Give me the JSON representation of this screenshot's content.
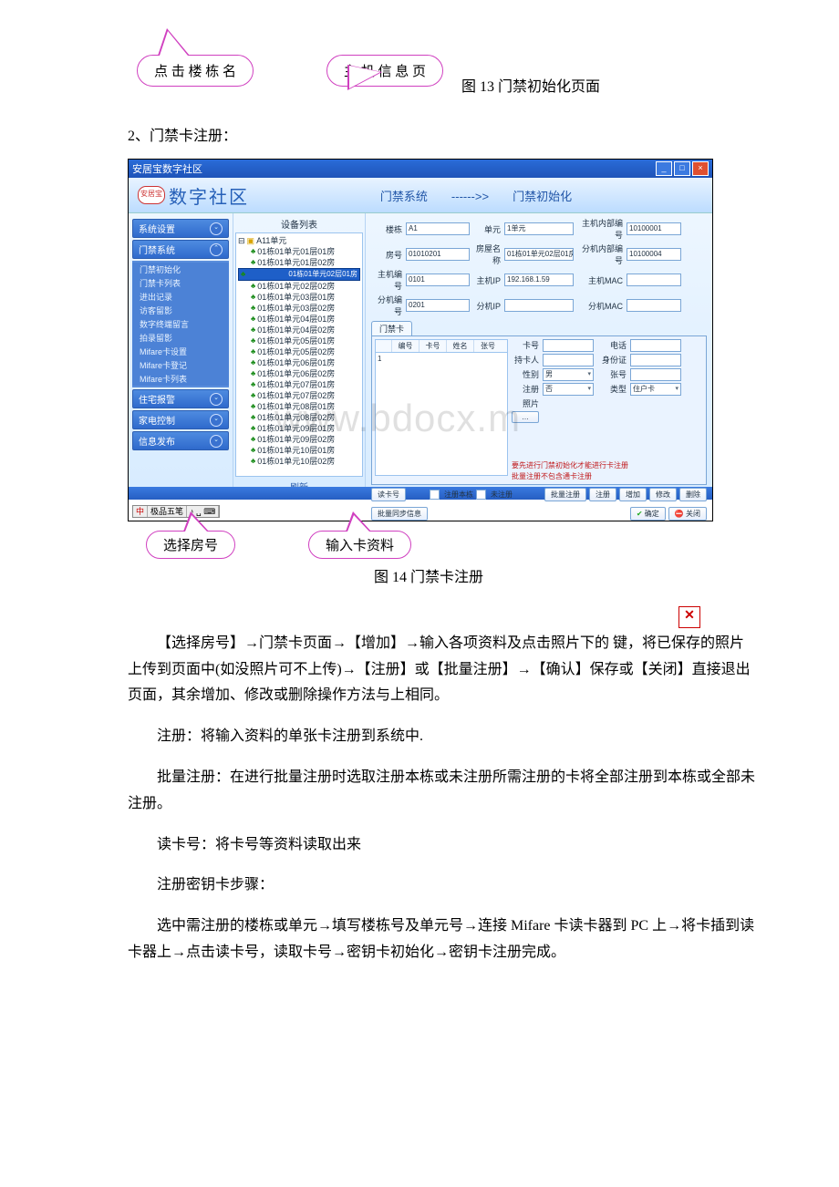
{
  "callouts_top": {
    "left": "点 击 楼 栋 名",
    "right": "主 机 信 息 页"
  },
  "fig13": "图 13 门禁初始化页面",
  "section2": "2、门禁卡注册：",
  "watermark": "www.bdocx.m",
  "screenshot": {
    "window_title": "安居宝数字社区",
    "logo_badge": "安居宝",
    "logo_text": "数字社区",
    "header_center": "门禁系统　　------>>　　门禁初始化",
    "leftnav": {
      "groups": [
        {
          "label": "系统设置",
          "items": []
        },
        {
          "label": "门禁系统",
          "items": [
            "门禁初始化",
            "门禁卡列表",
            "进出记录",
            "访客留影",
            "数字终端留言",
            "拍录留影",
            "Mifare卡设置",
            "Mifare卡登记",
            "Mifare卡列表"
          ]
        },
        {
          "label": "住宅报警",
          "items": []
        },
        {
          "label": "家电控制",
          "items": []
        },
        {
          "label": "信息发布",
          "items": []
        }
      ]
    },
    "tree": {
      "title": "设备列表",
      "root": "A11单元",
      "rows": [
        "01栋01单元01层01房",
        "01栋01单元01层02房",
        "01栋01单元02层01房",
        "01栋01单元02层02房",
        "01栋01单元03层01房",
        "01栋01单元03层02房",
        "01栋01单元04层01房",
        "01栋01单元04层02房",
        "01栋01单元05层01房",
        "01栋01单元05层02房",
        "01栋01单元06层01房",
        "01栋01单元06层02房",
        "01栋01单元07层01房",
        "01栋01单元07层02房",
        "01栋01单元08层01房",
        "01栋01单元08层02房",
        "01栋01单元09层01房",
        "01栋01单元09层02房",
        "01栋01单元10层01房",
        "01栋01单元10层02房"
      ],
      "selected_index": 2,
      "refresh": "刷新"
    },
    "form": {
      "l_block": "楼栋",
      "v_block": "A1",
      "l_unit": "单元",
      "v_unit": "1单元",
      "l_hostno": "主机内部编号",
      "v_hostno": "10100001",
      "l_room": "房号",
      "v_room": "01010201",
      "l_roomname": "房屋名称",
      "v_roomname": "01栋01单元02层01房",
      "l_extno": "分机内部编号",
      "v_extno": "10100004",
      "l_hostnum": "主机编号",
      "v_hostnum": "0101",
      "l_hostip": "主机IP",
      "v_hostip": "192.168.1.59",
      "l_hostmac": "主机MAC",
      "v_hostmac": "",
      "l_extnum": "分机编号",
      "v_extnum": "0201",
      "l_extip": "分机IP",
      "v_extip": "",
      "l_extmac": "分机MAC",
      "v_extmac": ""
    },
    "tab": {
      "name": "门禁卡",
      "cols": [
        "",
        "编号",
        "卡号",
        "姓名",
        "张号"
      ],
      "row1": "1"
    },
    "rightform": {
      "l_cardno": "卡号",
      "v_cardno": "",
      "l_phone": "电话",
      "v_phone": "",
      "l_holder": "持卡人",
      "v_holder": "",
      "l_idcard": "身份证",
      "v_idcard": "",
      "l_gender": "性别",
      "v_gender": "男",
      "l_zhang": "张号",
      "v_zhang": "",
      "l_reg": "注册",
      "v_reg": "否",
      "l_type": "类型",
      "v_type": "住户卡",
      "l_photo": "照片",
      "photo_btn": "…",
      "warn1": "要先进行门禁初始化才能进行卡注册",
      "warn2": "批量注册不包含通卡注册"
    },
    "btns": {
      "readcard": "读卡号",
      "regblock": "注册本栋",
      "unreg": "未注册",
      "batchreg": "批量注册",
      "reg": "注册",
      "add": "增加",
      "modify": "修改",
      "delete": "删除",
      "batchsync": "批量同步信息",
      "ok": "确定",
      "close": "关闭"
    },
    "ime": {
      "seg1": "极品五笔",
      "seg_icons": "♪  ␣  ⌨"
    }
  },
  "callouts_mid": {
    "left": "选择房号",
    "right": "输入卡资料"
  },
  "fig14": "图 14 门禁卡注册",
  "steps_para_pre": "【选择房号】→门禁卡页面→【增加】→输入各项资料及点击照片下的",
  "steps_para_post": "键，将已保存的照片上传到页面中(如没照片可不上传)→【注册】或【批量注册】→【确认】保存或【关闭】直接退出页面，其余增加、修改或删除操作方法与上相同。",
  "para_reg": "注册：将输入资料的单张卡注册到系统中.",
  "para_batch": "批量注册：在进行批量注册时选取注册本栋或未注册所需注册的卡将全部注册到本栋或全部未注册。",
  "para_read": "读卡号：将卡号等资料读取出来",
  "para_key_h": "注册密钥卡步骤：",
  "para_key": "选中需注册的楼栋或单元→填写楼栋号及单元号→连接 Mifare 卡读卡器到 PC 上→将卡插到读卡器上→点击读卡号，读取卡号→密钥卡初始化→密钥卡注册完成。"
}
